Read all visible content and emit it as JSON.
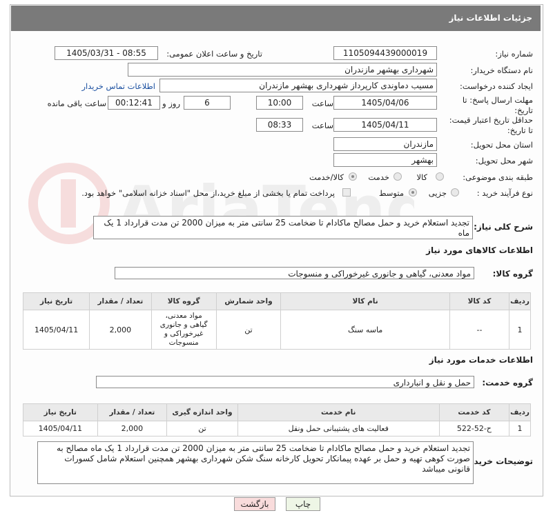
{
  "header": {
    "title": "جزئیات اطلاعات نیاز"
  },
  "fields": {
    "need_number_label": "شماره نیاز:",
    "need_number": "1105094439000019",
    "announce_label": "تاریخ و ساعت اعلان عمومی:",
    "announce_value": "1405/03/31 - 08:55",
    "buyer_label": "نام دستگاه خریدار:",
    "buyer_value": "شهرداری بهشهر مازندران",
    "creator_label": "ایجاد کننده درخواست:",
    "creator_value": "مسیب دماوندی کارپرداز شهرداری بهشهر مازندران",
    "contact_link": "اطلاعات تماس خریدار",
    "deadline_label": "مهلت ارسال پاسخ: تا تاریخ:",
    "deadline_date": "1405/04/06",
    "time_label": "ساعت",
    "deadline_time": "10:00",
    "days_value": "6",
    "days_label": "روز و",
    "remaining_time": "00:12:41",
    "remaining_label": "ساعت باقی مانده",
    "validity_label": "حداقل تاریخ اعتبار قیمت: تا تاریخ:",
    "validity_date": "1405/04/11",
    "validity_time": "08:33",
    "province_label": "استان محل تحویل:",
    "province_value": "مازندران",
    "city_label": "شهر محل تحویل:",
    "city_value": "بهشهر",
    "category_label": "طبقه بندی موضوعی:",
    "category_options": [
      "کالا",
      "خدمت",
      "کالا/خدمت"
    ],
    "process_label": "نوع فرآیند خرید :",
    "process_options": [
      "جزیی",
      "متوسط"
    ],
    "payment_note": "پرداخت تمام یا بخشی از مبلغ خرید،از محل \"اسناد خزانه اسلامی\" خواهد بود."
  },
  "description": {
    "label": "شرح کلی نیاز:",
    "value": "تجدید استعلام خرید و حمل مصالح ماکادام تا ضخامت 25 سانتی متر به میزان 2000 تن مدت قرارداد 1 یک ماه"
  },
  "goods": {
    "section_title": "اطلاعات کالاهای مورد نیاز",
    "group_label": "گروه کالا:",
    "group_value": "مواد معدنی، گیاهی و جانوری غیرخوراکی و منسوجات",
    "columns": [
      "ردیف",
      "کد کالا",
      "نام کالا",
      "واحد شمارش",
      "گروه کالا",
      "تعداد / مقدار",
      "تاریخ نیاز"
    ],
    "rows": [
      {
        "row": "1",
        "code": "--",
        "name": "ماسه سنگ",
        "unit": "تن",
        "group": "مواد معدنی، گیاهی و جانوری غیرخوراکی و منسوجات",
        "qty": "2,000",
        "date": "1405/04/11"
      }
    ]
  },
  "services": {
    "section_title": "اطلاعات خدمات مورد نیاز",
    "group_label": "گروه خدمت:",
    "group_value": "حمل و نقل و انبارداری",
    "columns": [
      "ردیف",
      "کد خدمت",
      "نام خدمت",
      "واحد اندازه گیری",
      "تعداد / مقدار",
      "تاریخ نیاز"
    ],
    "rows": [
      {
        "row": "1",
        "code": "ح-52-522",
        "name": "فعالیت های پشتیبانی حمل ونقل",
        "unit": "تن",
        "qty": "2,000",
        "date": "1405/04/11"
      }
    ]
  },
  "buyer_notes": {
    "label": "توضیحات خریدار:",
    "value": "تجدید استعلام  خرید و حمل مصالح ماکادام تا ضخامت 25 سانتی متر به میزان 2000 تن مدت قرارداد 1 یک ماه مصالح به صورت کوهی تهیه و حمل بر عهده پیمانکار تحویل کارخانه سنگ شکن شهرداری بهشهر همچنین استعلام شامل کسورات قانونی میباشد"
  },
  "buttons": {
    "print": "چاپ",
    "back": "بازگشت"
  },
  "colors": {
    "header_bg": "#7a7a7a",
    "back_btn_bg": "#f9dcdc",
    "print_btn_bg": "#eef6e6",
    "link": "#1a4fa0"
  }
}
